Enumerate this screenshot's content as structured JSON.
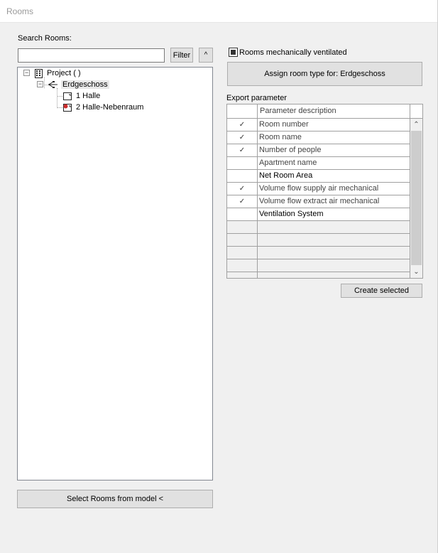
{
  "window": {
    "title": "Rooms"
  },
  "search": {
    "label": "Search Rooms:",
    "value": "",
    "placeholder": ""
  },
  "buttons": {
    "filter": "Filter",
    "collapse": "^",
    "assign_room_type": "Assign room type for: Erdgeschoss",
    "create_selected": "Create selected",
    "select_rooms": "Select Rooms from model <"
  },
  "tree": {
    "root": {
      "label": "Project ( )",
      "icon": "building-icon",
      "expander": "−"
    },
    "level": {
      "label": "Erdgeschoss",
      "icon": "level-icon",
      "expander": "−"
    },
    "rooms": [
      {
        "label": "1 Halle",
        "icon": "room-icon"
      },
      {
        "label": "2 Halle-Nebenraum",
        "icon": "room-warning-icon"
      }
    ]
  },
  "ventilated": {
    "label": "Rooms mechanically ventilated",
    "checked": "indeterminate"
  },
  "export": {
    "label": "Export parameter",
    "column_header": "Parameter description",
    "rows": [
      {
        "check": "✓",
        "desc": "Room number"
      },
      {
        "check": "✓",
        "desc": "Room name"
      },
      {
        "check": "✓",
        "desc": "Number of people"
      },
      {
        "check": "",
        "desc": "Apartment name"
      },
      {
        "check": "",
        "desc": "Net Room Area"
      },
      {
        "check": "✓",
        "desc": "Volume flow supply air mechanical"
      },
      {
        "check": "✓",
        "desc": "Volume flow extract air mechanical"
      },
      {
        "check": "",
        "desc": "Ventilation System"
      }
    ],
    "scroll_up": "⌃",
    "scroll_down": "⌄"
  },
  "colors": {
    "window_bg": "#f0f0f0",
    "border": "#a0a0a0",
    "button_bg": "#e1e1e1"
  }
}
